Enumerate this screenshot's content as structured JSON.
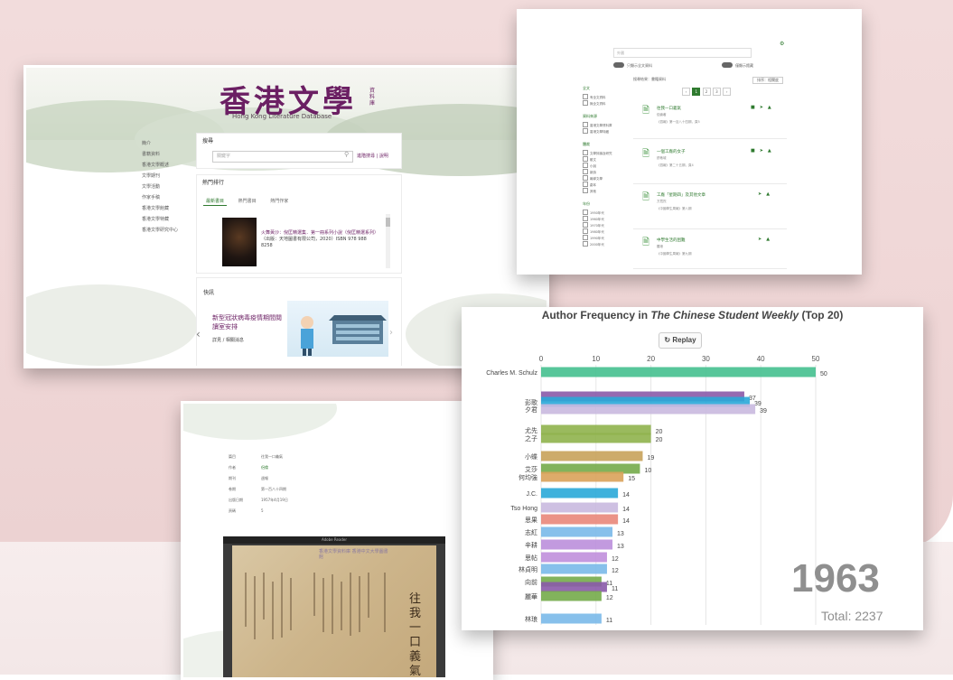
{
  "screenshot1": {
    "title": "香港文學",
    "seal": "資料庫",
    "subtitle": "Hong Kong Literature Database",
    "nav": [
      "簡介",
      "書籍資料",
      "香港文學概述",
      "文學期刊",
      "文學活動",
      "作家手稿",
      "香港文學館藏",
      "香港文學特藏",
      "香港文學研究中心"
    ],
    "search_heading": "搜尋",
    "search_placeholder": "關鍵字",
    "advanced_label": "進階搜尋 | 說明",
    "popular_heading": "熱門排行",
    "tabs": [
      "最新書目",
      "熱門書目",
      "熱門作家"
    ],
    "book_title": "火舞黃沙：倪匡精選集．第一冊系列小說（倪匡精選系列）",
    "book_meta": "（出版：天地圖書有限公司，2020）ISBN 978 988 8258",
    "news_heading": "快訊",
    "news_text": "新型冠狀病毒疫情期間閱讀室安排",
    "news_more": "詳見 / 相關消息"
  },
  "screenshot2": {
    "search_value": "外國",
    "toggle1": "只顯示全文資料",
    "toggle2": "僅顯示館藏",
    "sort_label": "排序：相關度",
    "results_label": "搜尋結果：書籍資料",
    "pages": [
      "‹",
      "1",
      "2",
      "3",
      "›"
    ],
    "sections": [
      {
        "heading": "全文",
        "items": [
          "有全文資料",
          "無全文資料"
        ]
      },
      {
        "heading": "資料來源",
        "items": [
          "香港文學資料庫",
          "香港文學特藏"
        ]
      },
      {
        "heading": "體裁",
        "items": [
          "文學評論及研究",
          "散文",
          "小說",
          "新詩",
          "報導文學",
          "劇本",
          "其他"
        ]
      },
      {
        "heading": "年份",
        "items": [
          "1950年代",
          "1960年代",
          "1970年代",
          "1980年代",
          "1990年代",
          "2000年代"
        ]
      }
    ],
    "results": [
      {
        "title": "往我一口義氣",
        "meta1": "侶倫著",
        "meta2": "《週報》第一百八十四期，頁5"
      },
      {
        "title": "一個工廠的女子",
        "meta1": "舒巷城",
        "meta2": "《週報》第二十五期，頁4"
      },
      {
        "title": "工廠「星期四」及其他文章",
        "meta1": "方寬烈",
        "meta2": "《中國學生周報》第八期"
      },
      {
        "title": "中學生活的困難",
        "meta1": "羅琅",
        "meta2": "《中國學生周報》第九期"
      }
    ]
  },
  "screenshot3": {
    "rows": [
      {
        "label": "篇目",
        "value": "往我一口義氣"
      },
      {
        "label": "作者",
        "value": "侶倫"
      },
      {
        "label": "期刊",
        "value": "週報"
      },
      {
        "label": "卷期",
        "value": "第一百八十四期"
      },
      {
        "label": "出版日期",
        "value": "1957年4月19日"
      },
      {
        "label": "頁碼",
        "value": "5"
      }
    ],
    "viewer_label": "Adobe Reader",
    "page_title": "往我一口義氣",
    "stamp": "香港文學資料庫 香港中文大學圖書館"
  },
  "chart_data": {
    "type": "bar",
    "title_prefix": "Author Frequency in ",
    "title_italic": "The Chinese Student Weekly",
    "title_suffix": " (Top 20)",
    "replay_label": "Replay",
    "xlim": [
      0,
      50
    ],
    "xticks": [
      0,
      10,
      20,
      30,
      40,
      50
    ],
    "year": "1963",
    "total_label": "Total: 2237",
    "bars": [
      {
        "label": "Charles M. Schulz",
        "value": 50,
        "color": "#45c08f"
      },
      {
        "label": "",
        "value": 37,
        "color": "#8a5aa8"
      },
      {
        "label": "彭歌",
        "value": 38,
        "color": "#29a8d8"
      },
      {
        "label": "夕君",
        "value": 39,
        "color": "#c9b9df"
      },
      {
        "label": "尤先",
        "value": 20,
        "color": "#8fb24d"
      },
      {
        "label": "之子",
        "value": 20,
        "color": "#8fb24d"
      },
      {
        "label": "小蝶",
        "value": 18.5,
        "color": "#c8a25a"
      },
      {
        "label": "艾莎",
        "value": 18,
        "color": "#74ab4a"
      },
      {
        "label": "何均強",
        "value": 15,
        "color": "#d9a25a"
      },
      {
        "label": "J.C.",
        "value": 14,
        "color": "#29a8d8"
      },
      {
        "label": "Tso Hong",
        "value": 14,
        "color": "#c9b9df"
      },
      {
        "label": "思果",
        "value": 14,
        "color": "#e9877a"
      },
      {
        "label": "志紅",
        "value": 13,
        "color": "#7ab9e9"
      },
      {
        "label": "辛耕",
        "value": 13,
        "color": "#bb8fdc"
      },
      {
        "label": "思帖",
        "value": 12,
        "color": "#c08fdc"
      },
      {
        "label": "林貞明",
        "value": 12,
        "color": "#7ab9e9"
      },
      {
        "label": "向前",
        "value": 11,
        "color": "#74ab4a"
      },
      {
        "label": "",
        "value": 12,
        "color": "#8a5aa8"
      },
      {
        "label": "麗華",
        "value": 11,
        "color": "#74ab4a"
      },
      {
        "label": "林琅",
        "value": 11,
        "color": "#7ab9e9"
      }
    ],
    "value_labels": [
      "50",
      "37",
      "39",
      "39",
      "20",
      "20",
      "19",
      "10",
      "15",
      "14",
      "14",
      "14",
      "13",
      "13",
      "12",
      "12",
      "11",
      "11",
      "12",
      "11"
    ]
  }
}
